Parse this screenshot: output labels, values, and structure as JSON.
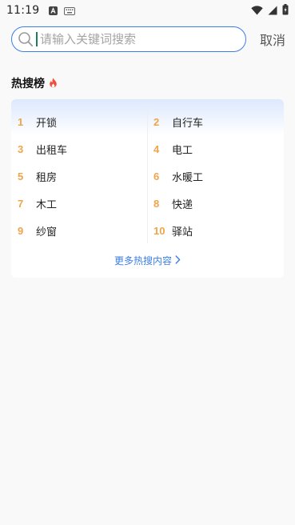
{
  "status_bar": {
    "time": "11:19"
  },
  "search": {
    "placeholder": "请输入关键词搜索",
    "value": "",
    "cancel_label": "取消"
  },
  "hot": {
    "title": "热搜榜",
    "items": [
      {
        "rank": "1",
        "keyword": "开锁"
      },
      {
        "rank": "2",
        "keyword": "自行车"
      },
      {
        "rank": "3",
        "keyword": "出租车"
      },
      {
        "rank": "4",
        "keyword": "电工"
      },
      {
        "rank": "5",
        "keyword": "租房"
      },
      {
        "rank": "6",
        "keyword": "水暖工"
      },
      {
        "rank": "7",
        "keyword": "木工"
      },
      {
        "rank": "8",
        "keyword": "快递"
      },
      {
        "rank": "9",
        "keyword": "纱窗"
      },
      {
        "rank": "10",
        "keyword": "驿站"
      }
    ],
    "more_label": "更多热搜内容"
  },
  "colors": {
    "accent": "#3d7ee6",
    "rank": "#f0a44a",
    "fire": "#f04e3e"
  }
}
